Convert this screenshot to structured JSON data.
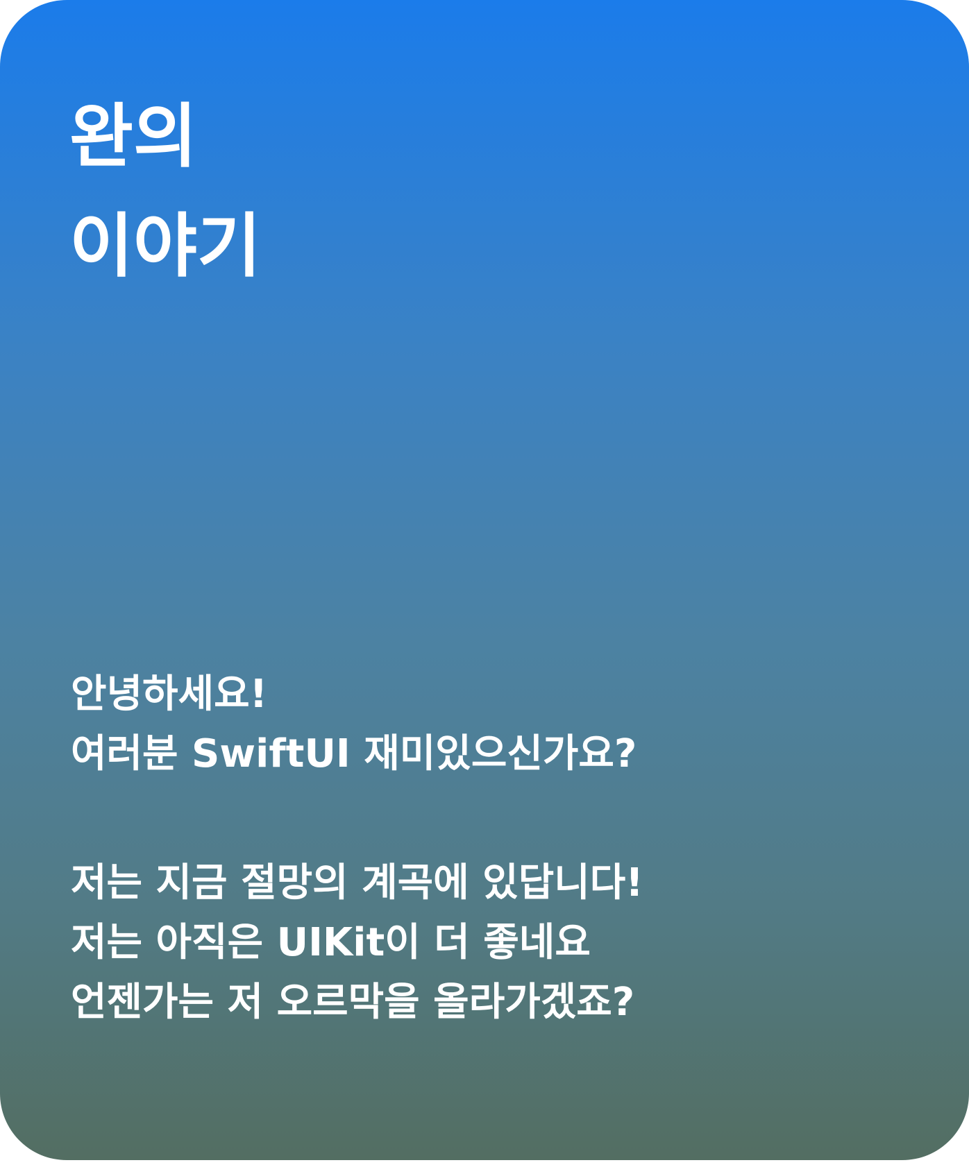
{
  "card": {
    "gradient_top": "#1b7cea",
    "gradient_bottom": "#536e62"
  },
  "title": {
    "line1": "완의",
    "line2": "이야기"
  },
  "message": {
    "greeting": "안녕하세요!",
    "question": "여러분 SwiftUI 재미있으신가요?",
    "line3": "저는 지금 절망의 계곡에 있답니다!",
    "line4": "저는 아직은 UIKit이 더 좋네요",
    "line5": "언젠가는 저 오르막을 올라가겠죠?"
  }
}
